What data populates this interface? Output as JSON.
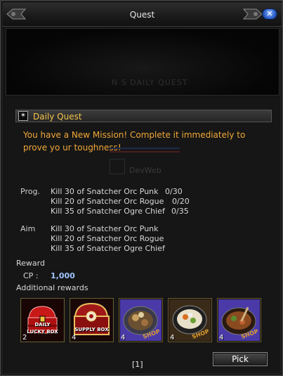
{
  "window": {
    "title": "Quest"
  },
  "banner": {
    "faint_text": "N  S DAILY QUEST"
  },
  "quest": {
    "header": "Daily Quest",
    "mission_text": "You have a New Mission! Complete it immediately to prove yo ur toughness!",
    "watermark": "DevWeb",
    "progress_label": "Prog.",
    "progress": [
      {
        "task": "Kill 30 of Snatcher Orc Punk",
        "count": "0/30"
      },
      {
        "task": "Kill 20 of Snatcher Orc Rogue",
        "count": "0/20"
      },
      {
        "task": "Kill 35 of Snatcher Ogre Chief",
        "count": "0/35"
      }
    ],
    "aim_label": "Aim",
    "aims": [
      "Kill 30 of Snatcher Orc Punk",
      "Kill 20 of Snatcher Orc Rogue",
      "Kill 35 of Snatcher Ogre Chief"
    ]
  },
  "reward": {
    "label": "Reward",
    "cp_label": "CP :",
    "cp_value": "1,000",
    "additional_label": "Additional rewards",
    "items": [
      {
        "name": "daily-lucky-box",
        "art_text_top": "DAILY",
        "art_text_bottom": "LUCKY BOX",
        "count": "2"
      },
      {
        "name": "supply-box",
        "art_text_top": "SUPPLY BOX",
        "count": "4"
      },
      {
        "name": "food-plate",
        "tag": "SHOP",
        "count": "4"
      },
      {
        "name": "soup-bowl",
        "tag": "SHOP",
        "count": "4"
      },
      {
        "name": "stew-bowl",
        "tag": "SHOP",
        "count": "4"
      }
    ]
  },
  "footer": {
    "page": "[1]",
    "pick_label": "Pick"
  },
  "colors": {
    "accent_title": "#f3c44a",
    "mission_text": "#f0a838",
    "cp_value": "#9fc4ff"
  }
}
